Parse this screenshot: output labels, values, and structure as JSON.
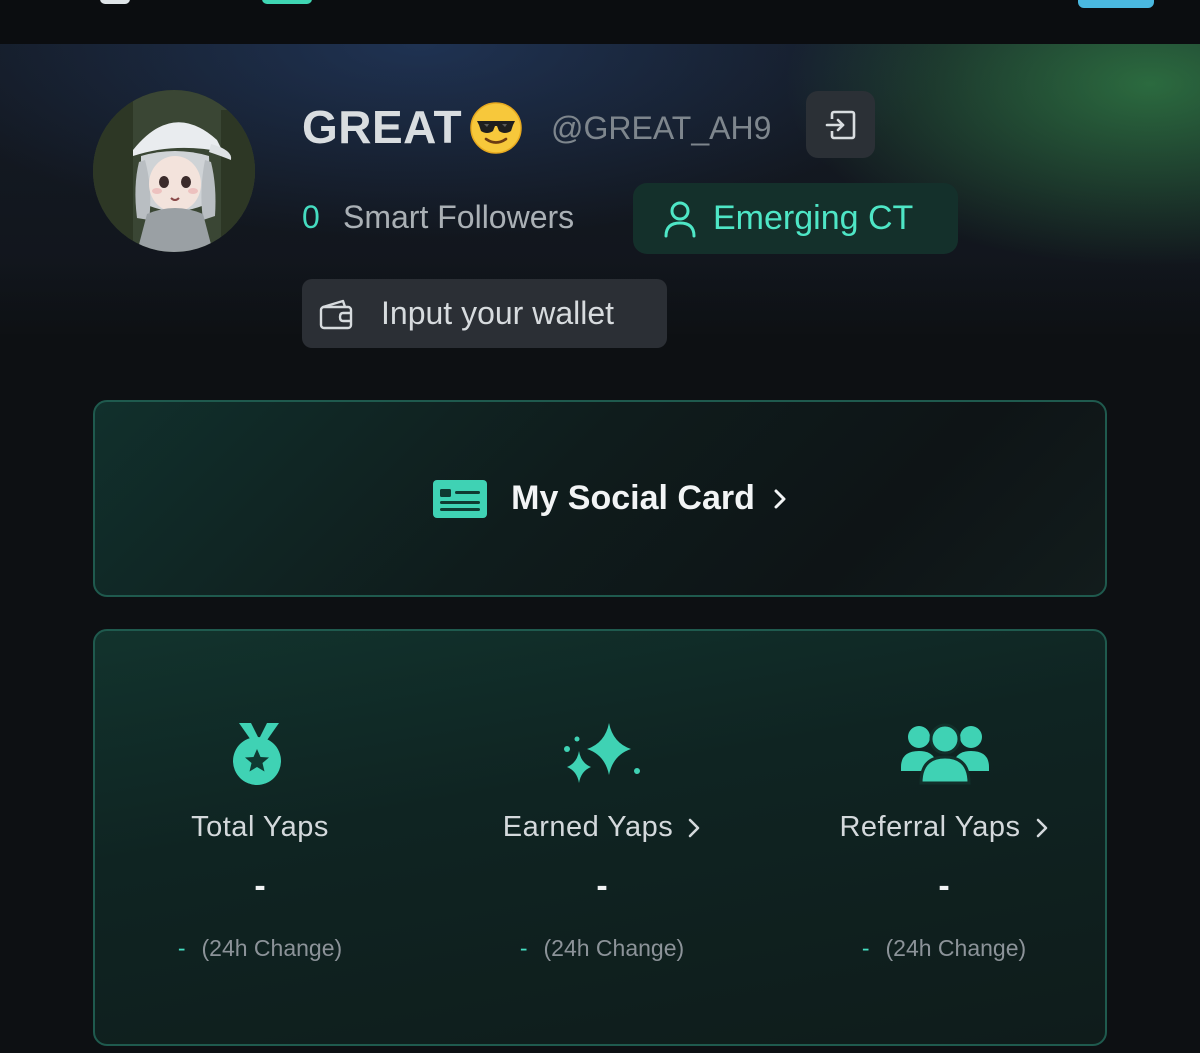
{
  "profile": {
    "display_name": "GREAT",
    "emoji_icon": "sunglasses-face-emoji",
    "handle": "@GREAT_AH9",
    "smart_followers_count": "0",
    "smart_followers_label": "Smart Followers",
    "tier_label": "Emerging CT",
    "wallet_prompt": "Input your wallet"
  },
  "social_card": {
    "label": "My Social Card"
  },
  "stats": [
    {
      "label": "Total Yaps",
      "value": "-",
      "change_value": "-",
      "change_label": "(24h Change)",
      "icon": "medal-icon"
    },
    {
      "label": "Earned Yaps",
      "value": "-",
      "change_value": "-",
      "change_label": "(24h Change)",
      "icon": "sparkles-icon"
    },
    {
      "label": "Referral Yaps",
      "value": "-",
      "change_value": "-",
      "change_label": "(24h Change)",
      "icon": "users-group-icon"
    }
  ],
  "colors": {
    "accent": "#45dcc0",
    "background": "#0d1013",
    "card_border": "#1f5a4e",
    "badge_bg": "#14302b"
  }
}
